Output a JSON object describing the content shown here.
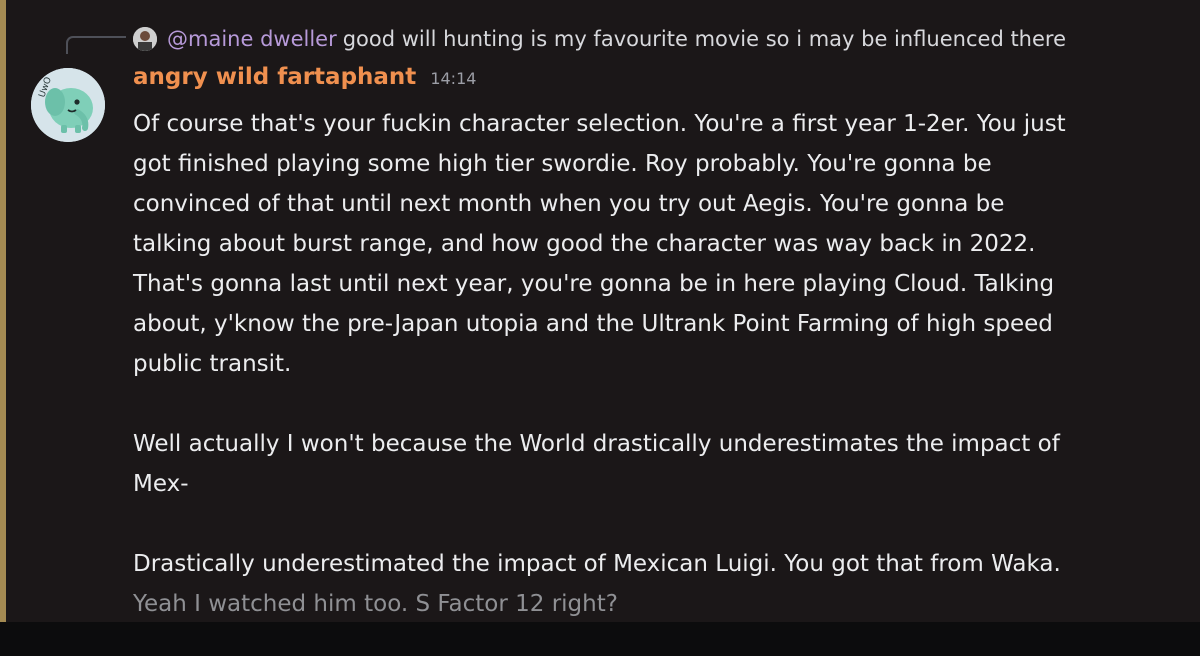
{
  "reply": {
    "mention": "@maine dweller",
    "text": "good will hunting is my favourite movie so i may be influenced there"
  },
  "message": {
    "username": "angry wild fartaphant",
    "timestamp": "14:14",
    "lines": [
      "Of course that's your fuckin character selection. You're a first year 1-2er. You just",
      "got finished playing some high tier swordie. Roy probably. You're gonna be",
      "convinced of that until next month when you try out Aegis. You're gonna be",
      "talking about burst range, and how good the character was way back in 2022.",
      "That's gonna last until next year, you're gonna be in here playing Cloud. Talking",
      "about, y'know the pre-Japan utopia and the Ultrank Point Farming of high speed",
      "public transit.",
      "",
      "Well actually I won't because the World drastically underestimates the impact of",
      "Mex-",
      "",
      "Drastically underestimated the impact of Mexican Luigi. You got that from Waka.",
      "Yeah I watched him too. S Factor 12 right?"
    ]
  },
  "colors": {
    "username": "#f0904f",
    "mention": "#b79ad9",
    "background": "#1b1718",
    "accent_bar": "#a48a52"
  }
}
